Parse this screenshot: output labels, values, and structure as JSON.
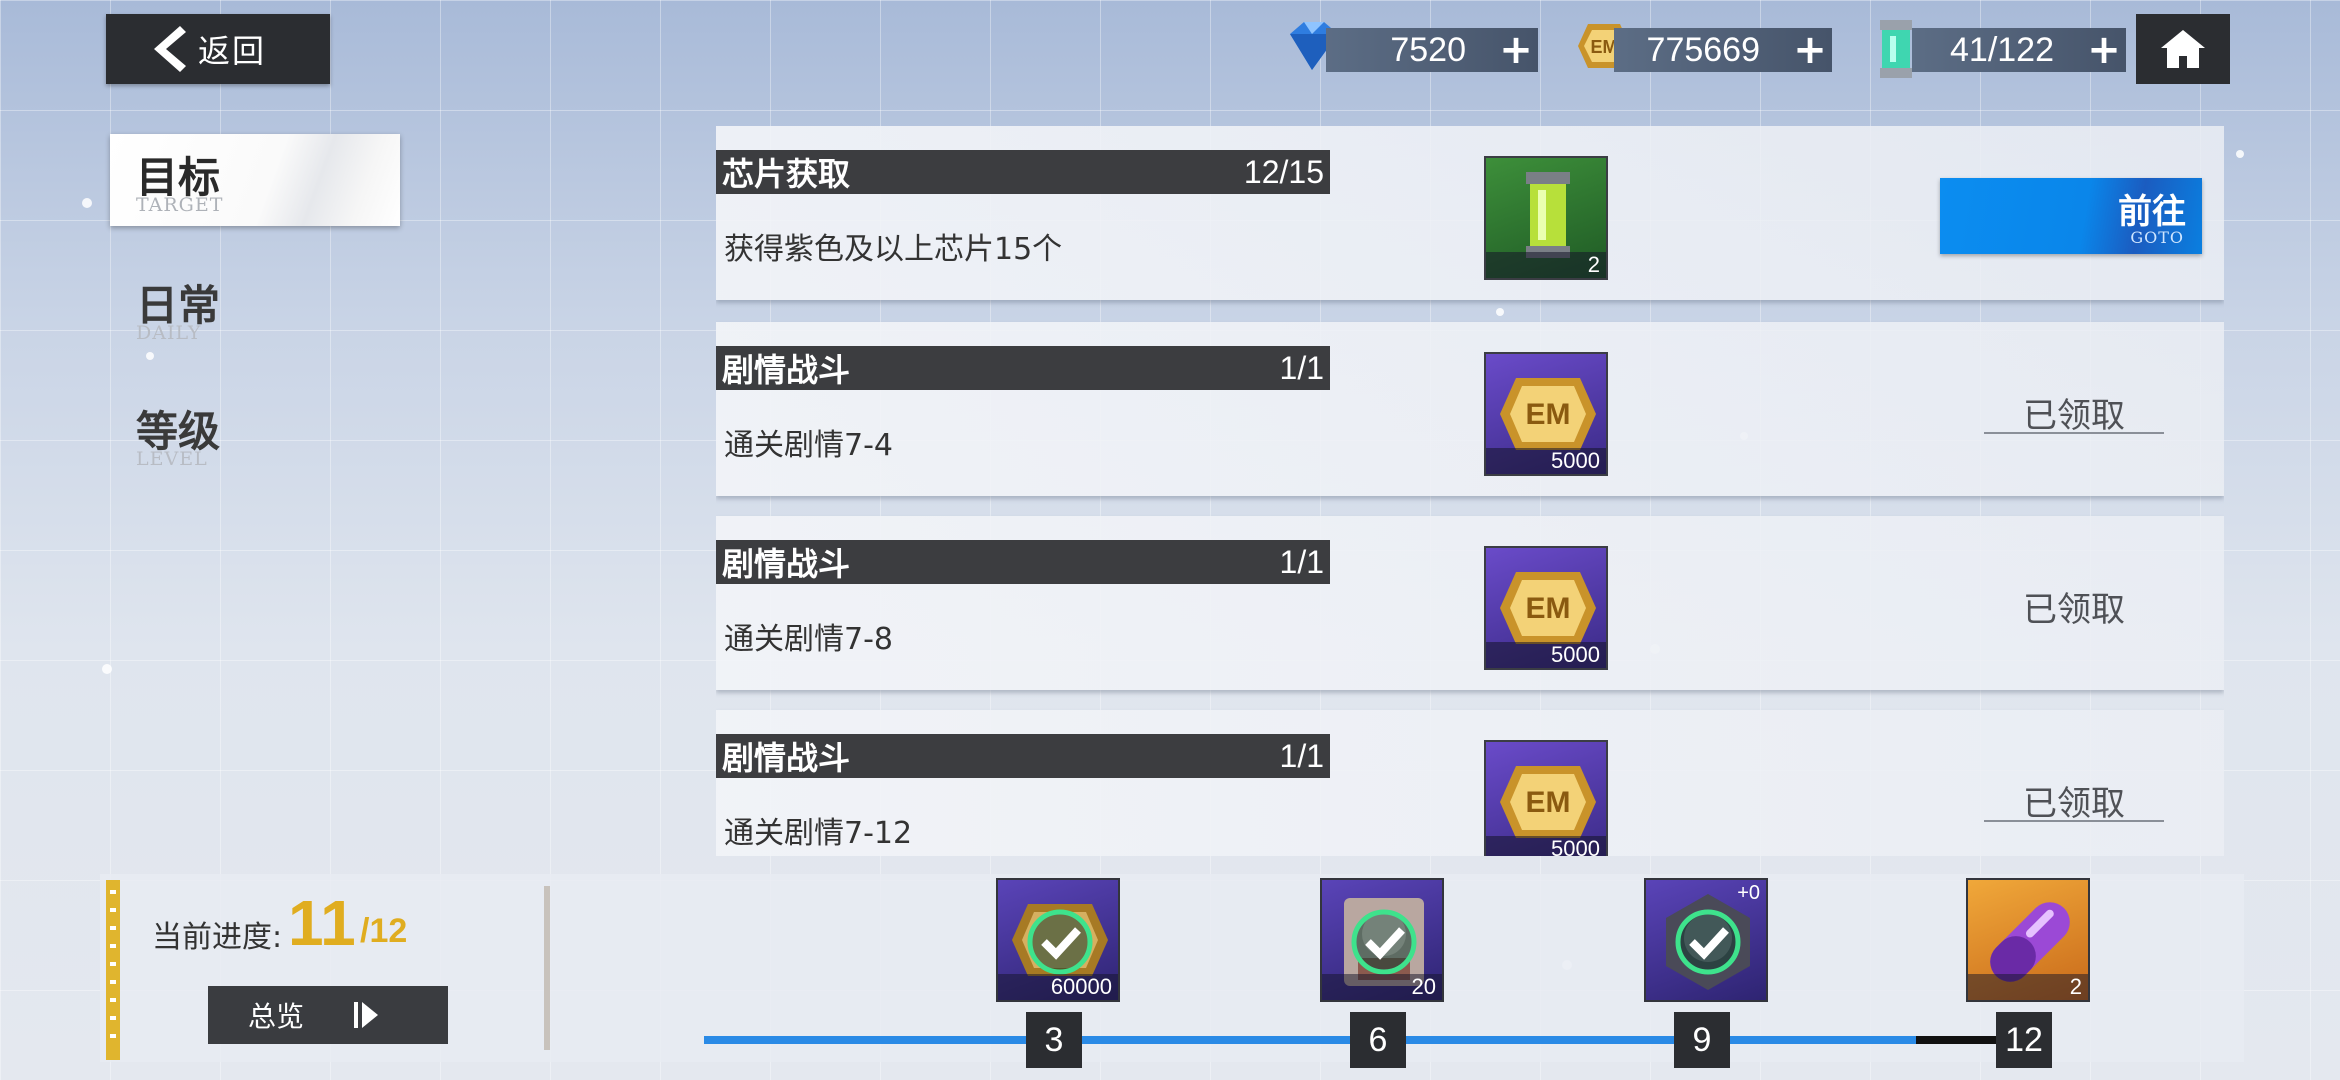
{
  "header": {
    "back_label": "返回",
    "resources": [
      {
        "icon": "diamond-icon",
        "value": "7520"
      },
      {
        "icon": "em-coin-icon",
        "value": "775669"
      },
      {
        "icon": "stamina-capsule-icon",
        "value": "41/122"
      }
    ],
    "plus_glyph": "+"
  },
  "sidebar": {
    "tabs": [
      {
        "label": "目标",
        "sub": "TARGET",
        "active": true
      },
      {
        "label": "日常",
        "sub": "DAILY",
        "active": false
      },
      {
        "label": "等级",
        "sub": "LEVEL",
        "active": false
      }
    ]
  },
  "tasks": [
    {
      "title": "芯片获取",
      "progress": "12/15",
      "desc": "获得紫色及以上芯片15个",
      "reward_icon": "chip-capsule-icon",
      "reward_qty": "2",
      "state": "goto",
      "button_label": "前往",
      "button_sub": "GOTO"
    },
    {
      "title": "剧情战斗",
      "progress": "1/1",
      "desc": "通关剧情7-4",
      "reward_icon": "em-coin-icon",
      "reward_qty": "5000",
      "state": "claimed",
      "button_label": "已领取"
    },
    {
      "title": "剧情战斗",
      "progress": "1/1",
      "desc": "通关剧情7-8",
      "reward_icon": "em-coin-icon",
      "reward_qty": "5000",
      "state": "claimed",
      "button_label": "已领取"
    },
    {
      "title": "剧情战斗",
      "progress": "1/1",
      "desc": "通关剧情7-12",
      "reward_icon": "em-coin-icon",
      "reward_qty": "5000",
      "state": "claimed",
      "button_label": "已领取"
    }
  ],
  "progress": {
    "label": "当前进度:",
    "current": "11",
    "max": "/12",
    "fraction": 0.917,
    "overview_label": "总览"
  },
  "milestones": [
    {
      "node": "3",
      "qty": "60000",
      "icon": "em-coin-icon",
      "claimed": true
    },
    {
      "node": "6",
      "qty": "20",
      "icon": "character-card-icon",
      "claimed": true
    },
    {
      "node": "9",
      "qty": "",
      "tag": "+0",
      "icon": "character-card-icon",
      "claimed": true
    },
    {
      "node": "12",
      "qty": "2",
      "icon": "capsule-icon",
      "claimed": false
    }
  ],
  "colors": {
    "accent_blue": "#0b8df0",
    "gold": "#e0ad20",
    "dark_bar": "#3c3d40",
    "check_green": "#3ee28c"
  }
}
